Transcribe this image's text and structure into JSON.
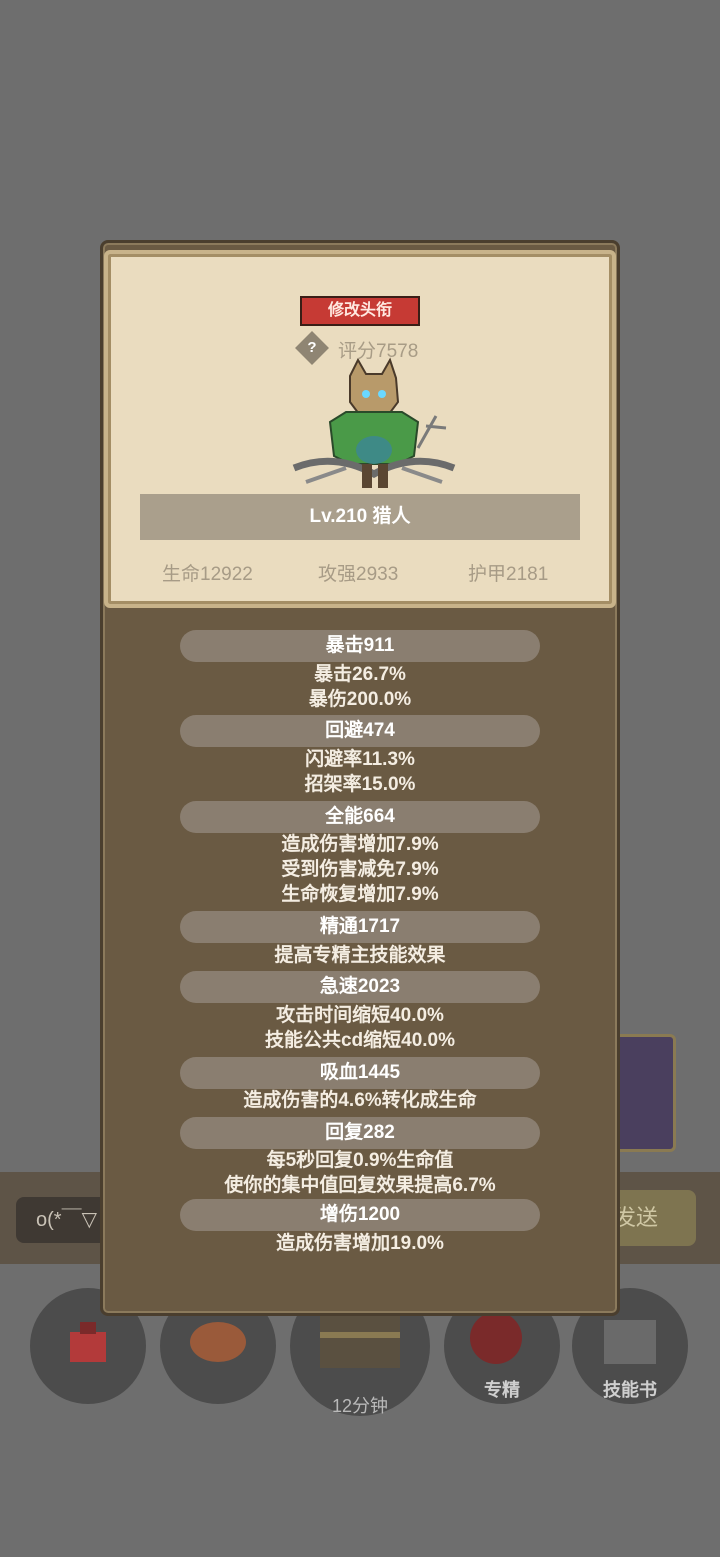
{
  "background": {
    "chat_input_text": "o(*￣▽",
    "send_button_text": "发送",
    "chest_timer": "12分钟",
    "bottom_buttons": [
      {
        "label": ""
      },
      {
        "label": ""
      },
      {
        "label": ""
      },
      {
        "label": "专精"
      },
      {
        "label": "技能书"
      }
    ]
  },
  "profile": {
    "edit_title_button": "修改头衔",
    "help_icon": "?",
    "score": "评分7578",
    "name_line": "Lv.210 猎人",
    "stats": {
      "life": "生命12922",
      "attack": "攻强2933",
      "armor": "护甲2181"
    }
  },
  "attributes": [
    {
      "header": "暴击911",
      "lines": [
        "暴击26.7%",
        "暴伤200.0%"
      ]
    },
    {
      "header": "回避474",
      "lines": [
        "闪避率11.3%",
        "招架率15.0%"
      ]
    },
    {
      "header": "全能664",
      "lines": [
        "造成伤害增加7.9%",
        "受到伤害减免7.9%",
        "生命恢复增加7.9%"
      ]
    },
    {
      "header": "精通1717",
      "lines": [
        "提高专精主技能效果"
      ]
    },
    {
      "header": "急速2023",
      "lines": [
        "攻击时间缩短40.0%",
        "技能公共cd缩短40.0%"
      ]
    },
    {
      "header": "吸血1445",
      "lines": [
        "造成伤害的4.6%转化成生命"
      ]
    },
    {
      "header": "回复282",
      "lines": [
        "每5秒回复0.9%生命值",
        "使你的集中值回复效果提高6.7%"
      ]
    },
    {
      "header": "增伤1200",
      "lines": [
        "造成伤害增加19.0%"
      ]
    }
  ],
  "colors": {
    "panel": "#6a5a43",
    "card": "#eadcbf",
    "edit_button": "#c63a34"
  }
}
